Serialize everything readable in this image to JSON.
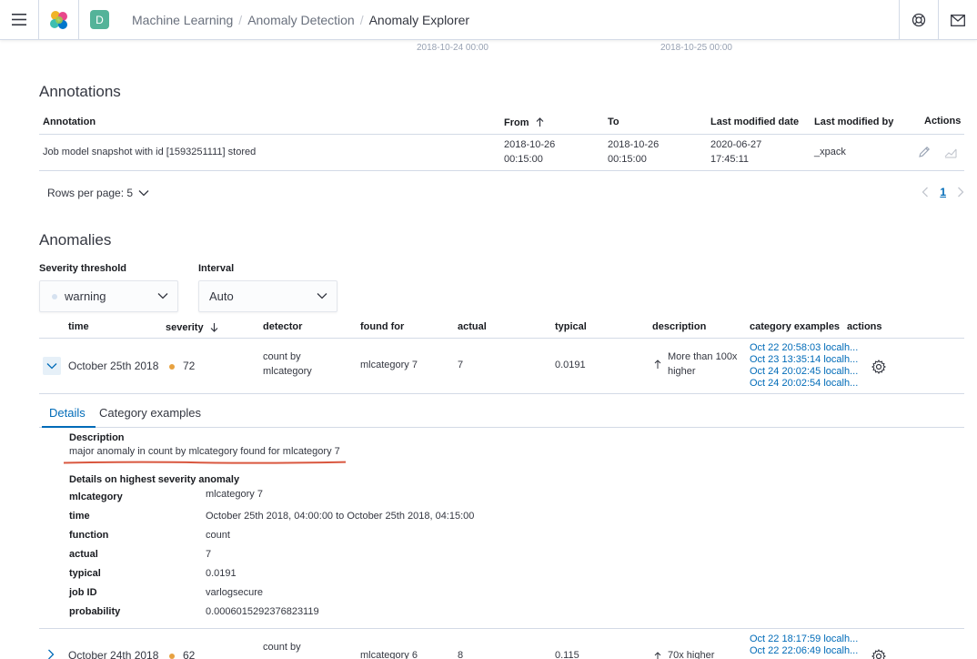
{
  "header": {
    "space_initial": "D",
    "breadcrumbs": [
      "Machine Learning",
      "Anomaly Detection",
      "Anomaly Explorer"
    ],
    "accent": "#006bb8"
  },
  "timeline": {
    "dates": [
      "2018-10-24 00:00",
      "2018-10-25 00:00"
    ]
  },
  "annotations": {
    "title": "Annotations",
    "columns": [
      "Annotation",
      "From",
      "To",
      "Last modified date",
      "Last modified by",
      "Actions"
    ],
    "rows": [
      {
        "annotation": "Job model snapshot with id [1593251111] stored",
        "from_date": "2018-10-26",
        "from_time": "00:15:00",
        "to_date": "2018-10-26",
        "to_time": "00:15:00",
        "modified_date": "2020-06-27",
        "modified_time": "17:45:11",
        "modified_by": "_xpack"
      }
    ],
    "rows_per_page": "Rows per page: 5",
    "page": "1"
  },
  "anomalies": {
    "title": "Anomalies",
    "severity_label": "Severity threshold",
    "severity_value": "warning",
    "interval_label": "Interval",
    "interval_value": "Auto",
    "columns": [
      "time",
      "severity",
      "detector",
      "found for",
      "actual",
      "typical",
      "description",
      "category examples",
      "actions"
    ],
    "rows": [
      {
        "time": "October 25th 2018",
        "severity": "72",
        "detector_1": "count by",
        "detector_2": "mlcategory",
        "found_for": "mlcategory 7",
        "actual": "7",
        "typical": "0.0191",
        "description_1": "More than 100x",
        "description_2": "higher",
        "examples": [
          "Oct 22 20:58:03 localh...",
          "Oct 23 13:35:14 localh...",
          "Oct 24 20:02:45 localh...",
          "Oct 24 20:02:54 localh..."
        ]
      },
      {
        "time": "October 24th 2018",
        "severity": "62",
        "detector_1": "count by",
        "found_for": "mlcategory 6",
        "actual": "8",
        "typical": "0.115",
        "description_1": "70x higher",
        "examples": [
          "Oct 22 18:17:59 localh...",
          "Oct 22 22:06:49 localh..."
        ]
      }
    ]
  },
  "details": {
    "tabs": [
      "Details",
      "Category examples"
    ],
    "description_title": "Description",
    "description": "major anomaly in count by mlcategory found for mlcategory 7",
    "highest_title": "Details on highest severity anomaly",
    "fields": [
      {
        "key": "mlcategory",
        "value": "mlcategory 7"
      },
      {
        "key": "time",
        "value": "October 25th 2018, 04:00:00 to October 25th 2018, 04:15:00"
      },
      {
        "key": "function",
        "value": "count"
      },
      {
        "key": "actual",
        "value": "7"
      },
      {
        "key": "typical",
        "value": "0.0191"
      },
      {
        "key": "job ID",
        "value": "varlogsecure"
      },
      {
        "key": "probability",
        "value": "0.0006015292376823119"
      }
    ]
  }
}
